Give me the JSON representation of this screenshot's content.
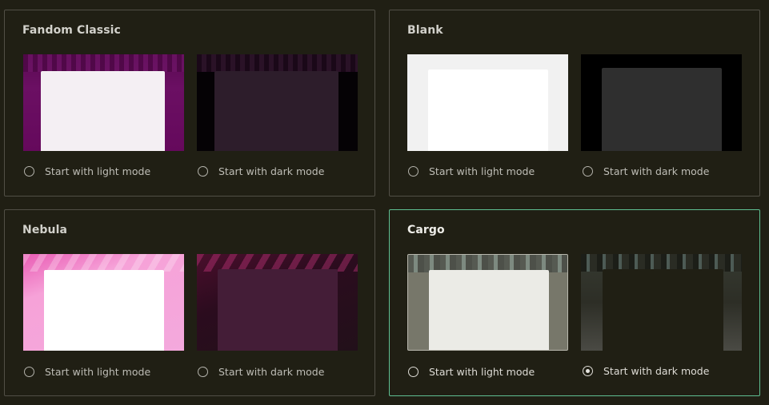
{
  "themes": [
    {
      "name": "Fandom Classic",
      "light_label": "Start with light mode",
      "dark_label": "Start with dark mode",
      "selected_mode": "none"
    },
    {
      "name": "Blank",
      "light_label": "Start with light mode",
      "dark_label": "Start with dark mode",
      "selected_mode": "none"
    },
    {
      "name": "Nebula",
      "light_label": "Start with light mode",
      "dark_label": "Start with dark mode",
      "selected_mode": "none"
    },
    {
      "name": "Cargo",
      "light_label": "Start with light mode",
      "dark_label": "Start with dark mode",
      "selected_mode": "dark"
    }
  ],
  "colors": {
    "background": "#201f14",
    "card_border": "#514f46",
    "selected_border": "#5fbf92"
  }
}
